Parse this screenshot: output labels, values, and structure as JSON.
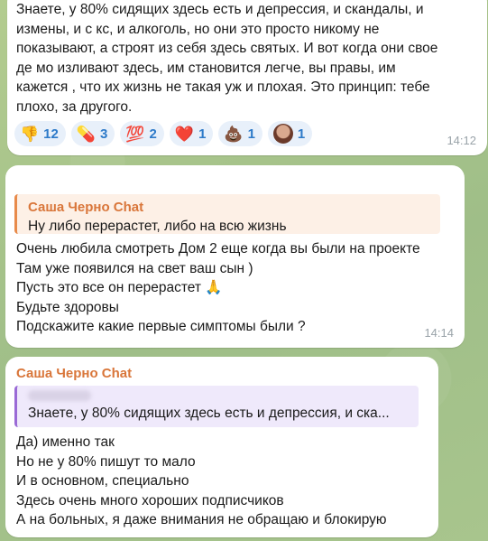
{
  "messages": [
    {
      "lines": [
        "Знаете, у 80% сидящих здесь есть и депрессия, и скандалы, и",
        "измены, и с  кс, и алкоголь, но они это просто никому не",
        "показывают, а строят из себя здесь святых.  И вот когда они свое",
        "де   мо изливают здесь, им становится легче, вы правы, им",
        "кажется , что   их жизнь не такая уж и плохая. Это принцип: тебе",
        "плохо, за     другого."
      ],
      "reactions": [
        {
          "emoji": "👎",
          "count": "12"
        },
        {
          "emoji": "💊",
          "count": "3"
        },
        {
          "emoji": "💯",
          "count": "2"
        },
        {
          "emoji": "❤️",
          "count": "1"
        },
        {
          "emoji": "💩",
          "count": "1"
        },
        {
          "emoji": "avatar",
          "count": "1"
        }
      ],
      "time": "14:12"
    },
    {
      "reply_name": "Саша Черно Chat",
      "reply_text": "Ну либо перерастет, либо на всю жизнь",
      "lines": [
        "Очень любила смотреть Дом 2 еще когда вы были на проекте",
        "Там уже появился на свет ваш сын )",
        "Пусть это все он перерастет 🙏",
        "Будьте здоровы",
        "Подскажите какие первые симптомы были ?"
      ],
      "time": "14:14"
    },
    {
      "sender": "Саша Черно Chat",
      "reply_text": "Знаете, у 80% сидящих здесь есть и депрессия, и ска...",
      "lines": [
        "Да) именно так",
        "Но не у 80% пишут то мало",
        "И в основном, специально",
        "Здесь очень много хороших подписчиков",
        "А на больных, я даже внимания не обращаю и блокирую"
      ]
    }
  ]
}
